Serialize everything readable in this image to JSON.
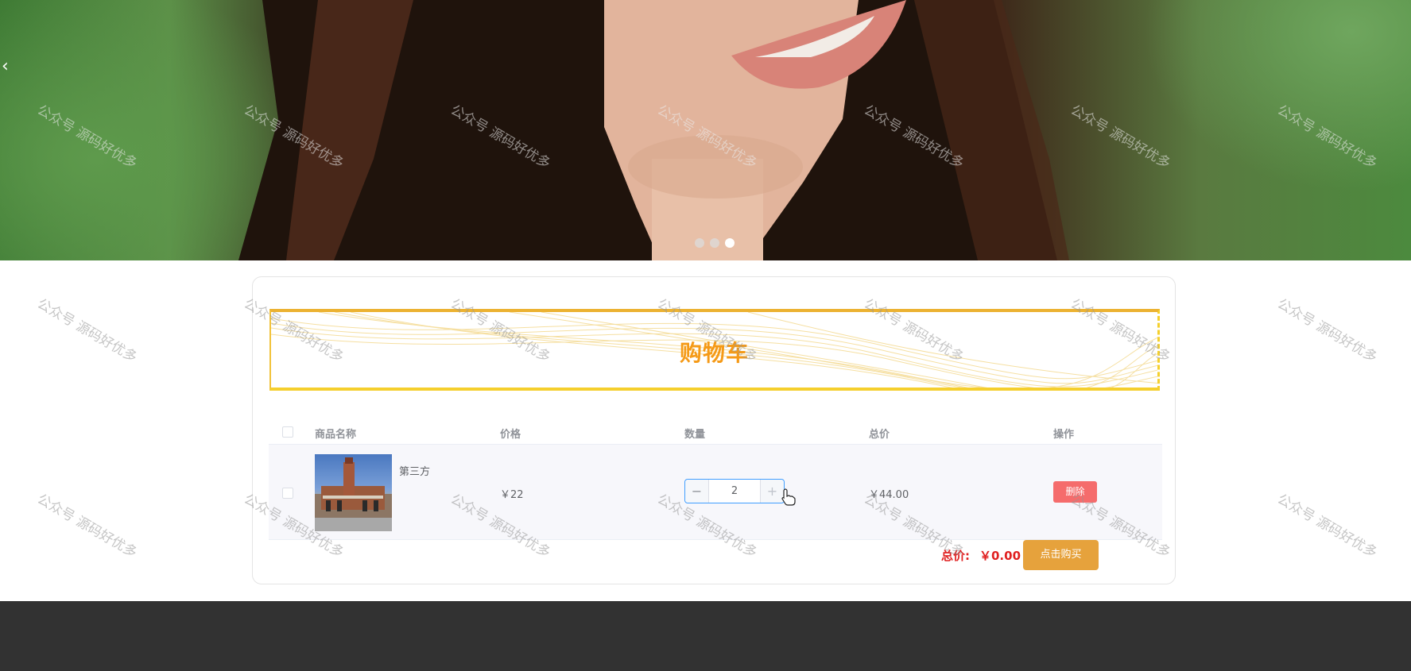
{
  "carousel": {
    "prev_arrow": "‹",
    "dots": [
      {
        "active": false
      },
      {
        "active": false
      },
      {
        "active": true
      }
    ]
  },
  "cart": {
    "title": "购物车",
    "headers": {
      "name": "商品名称",
      "price": "价格",
      "quantity": "数量",
      "total": "总价",
      "actions": "操作"
    },
    "items": [
      {
        "name": "第三方",
        "price": "￥22",
        "quantity": "2",
        "subtotal": "￥44.00",
        "delete_label": "删除"
      }
    ],
    "stepper": {
      "minus": "−",
      "plus": "+"
    },
    "footer": {
      "total_label": "总价:",
      "total_value": "￥0.00",
      "buy_label": "点击购买"
    }
  },
  "watermark": "公众号 源码好优多",
  "colors": {
    "accent_orange": "#f59a17",
    "buy_button": "#e6a23c",
    "delete_button": "#f56c6c",
    "total_red": "#e02020",
    "stepper_focus": "#409eff",
    "footer_bg": "#323232"
  },
  "icons": {
    "carousel_prev": "chevron-left-icon",
    "cursor": "hand-pointer-icon"
  }
}
